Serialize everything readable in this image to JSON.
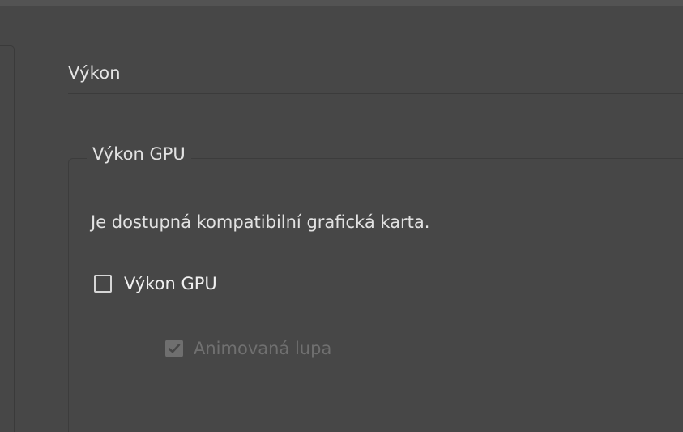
{
  "section": {
    "title": "Výkon"
  },
  "gpu_group": {
    "legend": "Výkon GPU",
    "info": "Je dostupná kompatibilní grafická karta.",
    "gpu_checkbox": {
      "label": "Výkon GPU",
      "checked": false
    },
    "animated_zoom_checkbox": {
      "label": "Animovaná lupa",
      "checked": true,
      "disabled": true
    }
  },
  "colors": {
    "background": "#474747",
    "text": "#e2e2e2",
    "disabled_text": "#707070",
    "divider": "#3b3b3b"
  },
  "icons": {
    "checkbox_unchecked": "checkbox-empty-icon",
    "checkbox_checked_disabled": "checkmark-icon"
  }
}
